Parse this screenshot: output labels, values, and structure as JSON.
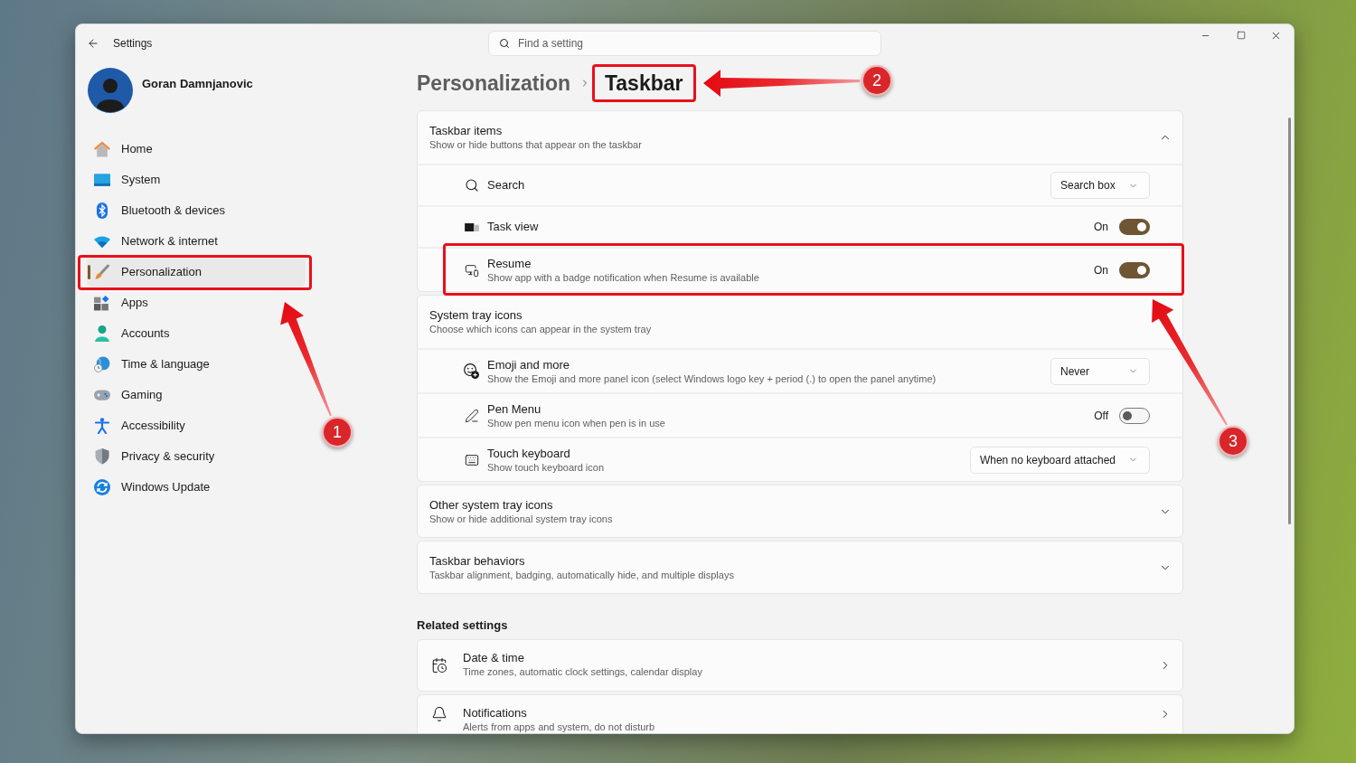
{
  "window": {
    "title": "Settings",
    "search": {
      "placeholder": "Find a setting"
    }
  },
  "user": {
    "name": "Goran Damnjanovic"
  },
  "sidebar": {
    "items": [
      {
        "label": "Home",
        "selected": false
      },
      {
        "label": "System",
        "selected": false
      },
      {
        "label": "Bluetooth & devices",
        "selected": false
      },
      {
        "label": "Network & internet",
        "selected": false
      },
      {
        "label": "Personalization",
        "selected": true
      },
      {
        "label": "Apps",
        "selected": false
      },
      {
        "label": "Accounts",
        "selected": false
      },
      {
        "label": "Time & language",
        "selected": false
      },
      {
        "label": "Gaming",
        "selected": false
      },
      {
        "label": "Accessibility",
        "selected": false
      },
      {
        "label": "Privacy & security",
        "selected": false
      },
      {
        "label": "Windows Update",
        "selected": false
      }
    ]
  },
  "breadcrumb": {
    "parent": "Personalization",
    "current": "Taskbar"
  },
  "sections": [
    {
      "kind": "expander",
      "title": "Taskbar items",
      "subtitle": "Show or hide buttons that appear on the taskbar",
      "expanded": true,
      "rows": [
        {
          "kind": "dropdown",
          "label": "Search",
          "value": "Search box"
        },
        {
          "kind": "toggle",
          "label": "Task view",
          "on": true,
          "state_label": "On"
        },
        {
          "kind": "toggle",
          "label": "Resume",
          "description": "Show app with a badge notification when Resume is available",
          "on": true,
          "state_label": "On"
        }
      ]
    },
    {
      "kind": "group",
      "title": "System tray icons",
      "subtitle": "Choose which icons can appear in the system tray",
      "rows": [
        {
          "kind": "dropdown",
          "label": "Emoji and more",
          "description": "Show the Emoji and more panel icon (select Windows logo key + period (.) to open the panel anytime)",
          "value": "Never"
        },
        {
          "kind": "toggle",
          "label": "Pen Menu",
          "description": "Show pen menu icon when pen is in use",
          "on": false,
          "state_label": "Off"
        },
        {
          "kind": "dropdown",
          "label": "Touch keyboard",
          "description": "Show touch keyboard icon",
          "value": "When no keyboard attached"
        }
      ]
    },
    {
      "kind": "expander",
      "title": "Other system tray icons",
      "subtitle": "Show or hide additional system tray icons",
      "expanded": false
    },
    {
      "kind": "expander",
      "title": "Taskbar behaviors",
      "subtitle": "Taskbar alignment, badging, automatically hide, and multiple displays",
      "expanded": false
    }
  ],
  "related_settings": {
    "heading": "Related settings",
    "items": [
      {
        "title": "Date & time",
        "subtitle": "Time zones, automatic clock settings, calendar display"
      },
      {
        "title": "Notifications",
        "subtitle": "Alerts from apps and system, do not disturb"
      }
    ]
  },
  "annotations": [
    {
      "number": "1"
    },
    {
      "number": "2"
    },
    {
      "number": "3"
    }
  ]
}
